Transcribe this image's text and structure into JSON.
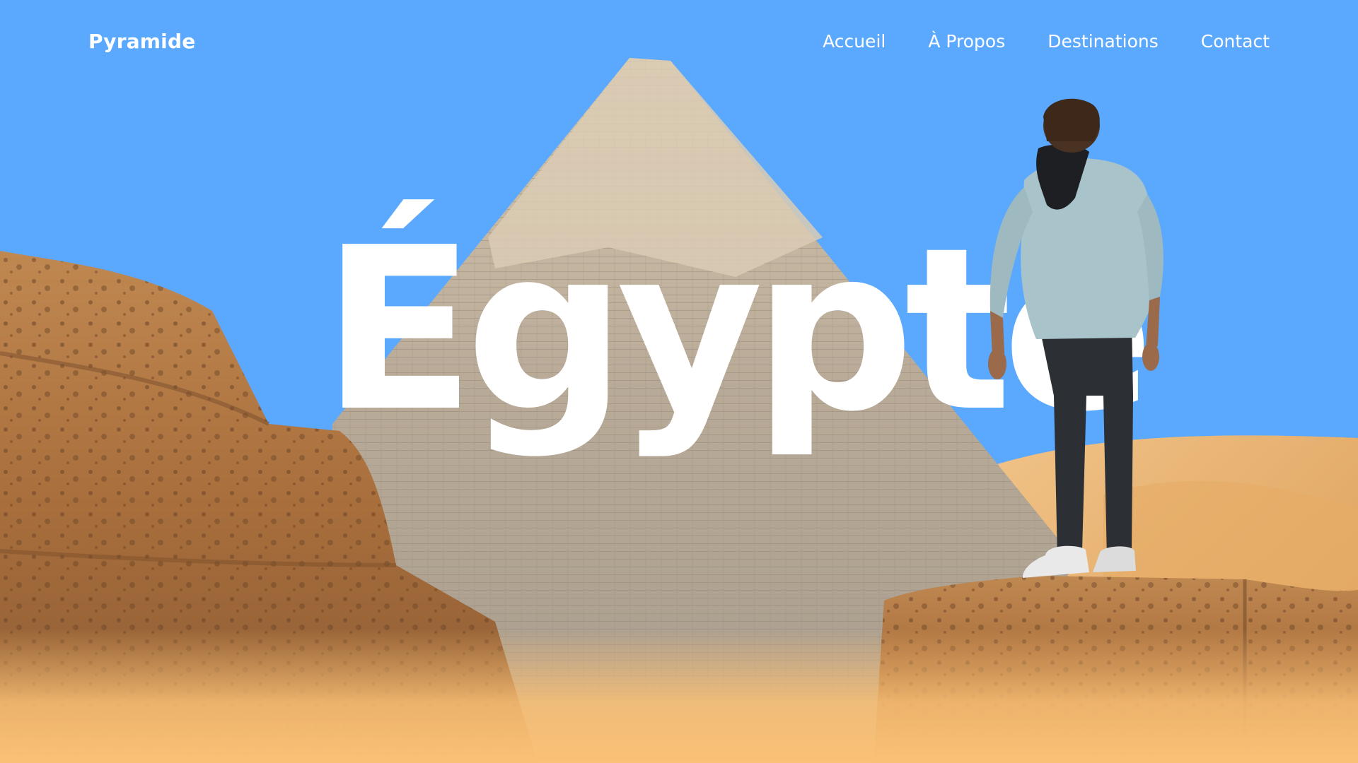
{
  "brand": {
    "name": "Pyramide"
  },
  "nav": {
    "items": [
      {
        "label": "Accueil"
      },
      {
        "label": "À Propos"
      },
      {
        "label": "Destinations"
      },
      {
        "label": "Contact"
      }
    ]
  },
  "hero": {
    "title": "Égypte"
  },
  "colors": {
    "sky": "#5aa9fe",
    "sand": "#fbc176",
    "text": "#ffffff"
  },
  "scene": {
    "elements": [
      "pyramid",
      "sand-dunes",
      "rock-left",
      "rock-right",
      "traveler"
    ]
  }
}
